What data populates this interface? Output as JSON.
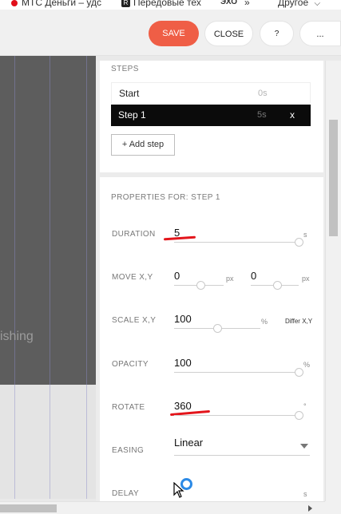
{
  "bookmarks": {
    "items": [
      "МТС Деньги – удс",
      "Передовые тех",
      "ЭХО",
      "»",
      "Другое"
    ],
    "fav_letter": "R"
  },
  "toolbar": {
    "save": "SAVE",
    "close": "CLOSE",
    "help": "?",
    "more": "..."
  },
  "canvas": {
    "text": "ishing"
  },
  "steps": {
    "title": "STEPS",
    "items": [
      {
        "name": "Start",
        "duration": "0s"
      },
      {
        "name": "Step 1",
        "duration": "5s",
        "remove": "x"
      }
    ],
    "add_label": "+ Add step"
  },
  "properties": {
    "title": "PROPERTIES FOR: STEP 1",
    "duration": {
      "label": "DURATION",
      "value": "5",
      "unit": "s"
    },
    "move": {
      "label": "MOVE X,Y",
      "x": "0",
      "y": "0",
      "unit": "px"
    },
    "scale": {
      "label": "SCALE X,Y",
      "value": "100",
      "unit": "%",
      "differ": "Differ X,Y"
    },
    "opacity": {
      "label": "OPACITY",
      "value": "100",
      "unit": "%"
    },
    "rotate": {
      "label": "ROTATE",
      "value": "360",
      "unit": "°"
    },
    "easing": {
      "label": "EASING",
      "value": "Linear"
    },
    "delay": {
      "label": "DELAY",
      "unit": "s"
    }
  },
  "colors": {
    "accent": "#ef5e46",
    "annotation": "#e3151b"
  }
}
